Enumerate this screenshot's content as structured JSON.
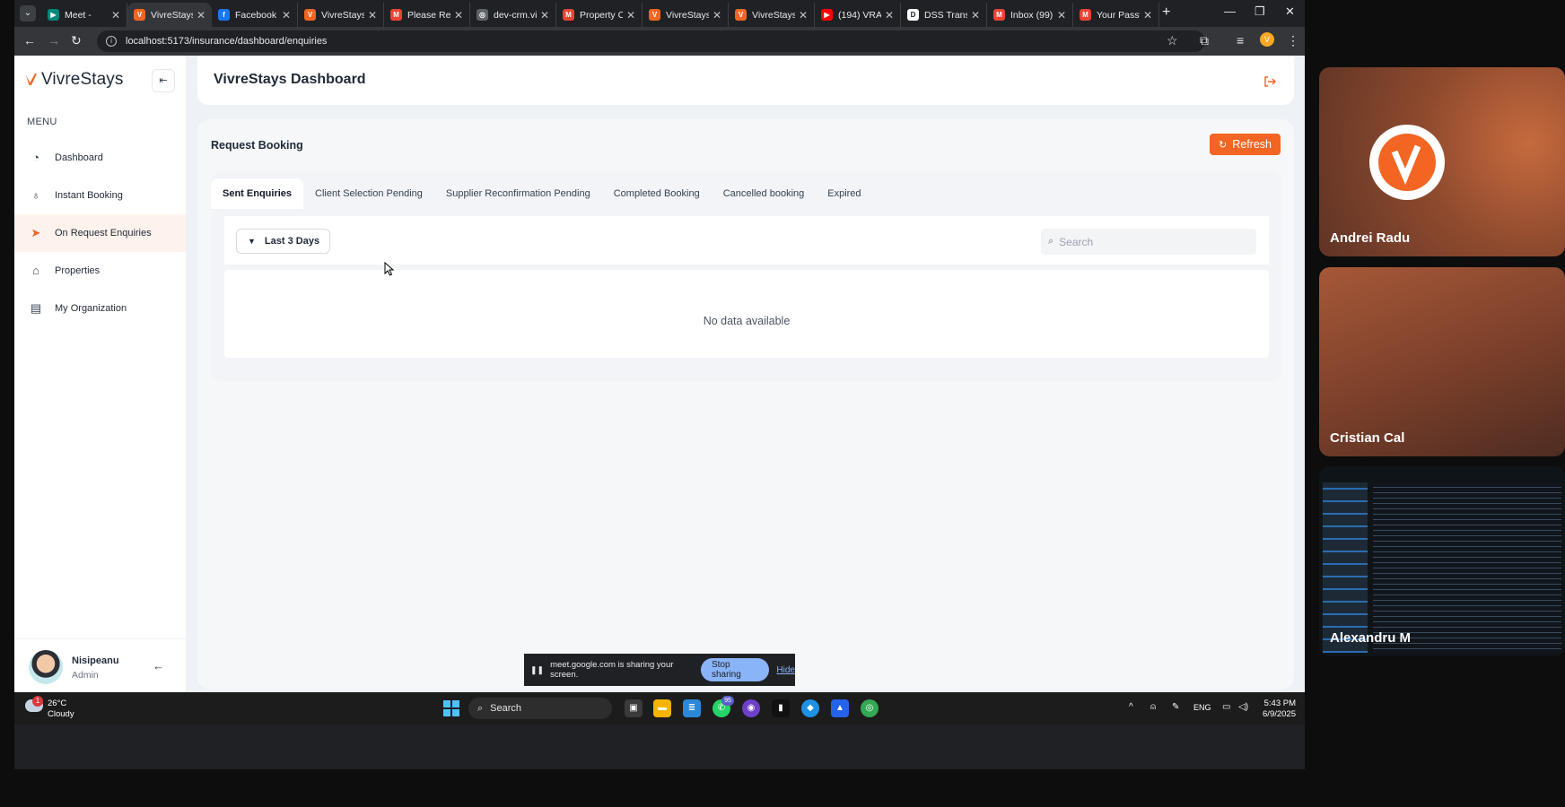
{
  "browser": {
    "tabs": [
      {
        "title": "Meet - ",
        "favicon": "meet-icon",
        "color": "#00897b",
        "active": false
      },
      {
        "title": "VivreStays",
        "favicon": "vivrestays-icon",
        "color": "#f26522",
        "active": true
      },
      {
        "title": "Facebook",
        "favicon": "facebook-icon",
        "color": "#1877f2",
        "active": false
      },
      {
        "title": "VivreStays",
        "favicon": "vivrestays-icon",
        "color": "#f26522",
        "active": false
      },
      {
        "title": "Please Rec",
        "favicon": "gmail-icon",
        "color": "#ea4335",
        "active": false
      },
      {
        "title": "dev-crm.vi",
        "favicon": "globe-icon",
        "color": "#9aa0a6",
        "active": false
      },
      {
        "title": "Property C",
        "favicon": "gmail-icon",
        "color": "#ea4335",
        "active": false
      },
      {
        "title": "VivreStays",
        "favicon": "vivrestays-icon",
        "color": "#f26522",
        "active": false
      },
      {
        "title": "VivreStays",
        "favicon": "vivrestays-icon",
        "color": "#f26522",
        "active": false
      },
      {
        "title": "(194) VRA",
        "favicon": "youtube-icon",
        "color": "#ff0000",
        "active": false
      },
      {
        "title": "DSS Trans",
        "favicon": "dss-icon",
        "color": "#ffffff",
        "active": false
      },
      {
        "title": "Inbox (99)",
        "favicon": "gmail-icon",
        "color": "#ea4335",
        "active": false
      },
      {
        "title": "Your Passw",
        "favicon": "gmail-icon",
        "color": "#ea4335",
        "active": false
      }
    ],
    "url": "localhost:5173/insurance/dashboard/enquiries"
  },
  "sidebar": {
    "brand": "VivreStays",
    "menu_label": "MENU",
    "items": [
      {
        "label": "Dashboard",
        "icon": "gauge-icon",
        "active": false
      },
      {
        "label": "Instant Booking",
        "icon": "bulb-icon",
        "active": false
      },
      {
        "label": "On Request Enquiries",
        "icon": "paper-plane-icon",
        "active": true
      },
      {
        "label": "Properties",
        "icon": "home-icon",
        "active": false
      },
      {
        "label": "My Organization",
        "icon": "building-icon",
        "active": false
      }
    ],
    "user": {
      "name": "Nisipeanu",
      "role": "Admin"
    }
  },
  "header": {
    "title": "VivreStays Dashboard"
  },
  "main": {
    "title": "Request Booking",
    "refresh_label": "Refresh",
    "tabs": [
      {
        "label": "Sent Enquiries",
        "active": true
      },
      {
        "label": "Client Selection Pending",
        "active": false
      },
      {
        "label": "Supplier Reconfirmation Pending",
        "active": false
      },
      {
        "label": "Completed Booking",
        "active": false
      },
      {
        "label": "Cancelled booking",
        "active": false
      },
      {
        "label": "Expired",
        "active": false
      }
    ],
    "range_label": "Last 3 Days",
    "search_placeholder": "Search",
    "empty_text": "No data available"
  },
  "share": {
    "text": "meet.google.com is sharing your screen.",
    "stop_label": "Stop sharing",
    "hide_label": "Hide"
  },
  "meet": {
    "participants": [
      {
        "name": "Andrei Radu"
      },
      {
        "name": "Cristian Cal"
      },
      {
        "name": "Alexandru M"
      }
    ]
  },
  "taskbar": {
    "weather_temp": "26°C",
    "weather_desc": "Cloudy",
    "weather_badge": "1",
    "search_label": "Search",
    "whatsapp_badge": "95",
    "lang": "ENG",
    "time": "5:43 PM",
    "date": "6/9/2025"
  },
  "colors": {
    "accent": "#f26522",
    "active_bg": "#fdf2ec"
  }
}
